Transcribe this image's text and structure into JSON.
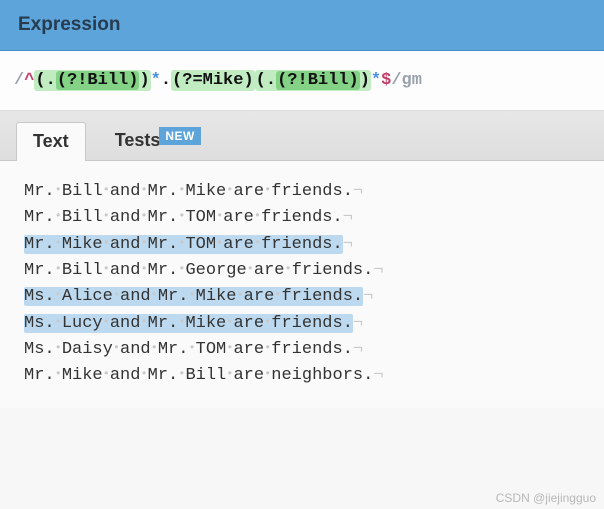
{
  "header": {
    "title": "Expression"
  },
  "regex": {
    "delim_open": "/",
    "anchor_start": "^",
    "group1_open": "(",
    "group1_dot": ".",
    "group1_la_open": "(?!",
    "group1_la_lit": "Bill",
    "group1_la_close": ")",
    "group1_close": ")",
    "star1": "*",
    "mid_dot": ".",
    "mid_la_open": "(?=",
    "mid_la_lit": "Mike",
    "mid_la_close": ")",
    "group2_open": "(",
    "group2_dot": ".",
    "group2_la_open": "(?!",
    "group2_la_lit": "Bill",
    "group2_la_close": ")",
    "group2_close": ")",
    "star2": "*",
    "anchor_end": "$",
    "delim_close": "/",
    "flags": "gm"
  },
  "tabs": {
    "text": "Text",
    "tests": "Tests",
    "badge": "NEW"
  },
  "lines": [
    {
      "text": "Mr. Bill and Mr. Mike are friends.",
      "matched": false
    },
    {
      "text": "Mr. Bill and Mr. TOM are friends.",
      "matched": false
    },
    {
      "text": "Mr. Mike and Mr. TOM are friends.",
      "matched": true
    },
    {
      "text": "Mr. Bill and Mr. George are friends.",
      "matched": false
    },
    {
      "text": "Ms. Alice and Mr. Mike are friends.",
      "matched": true
    },
    {
      "text": "Ms. Lucy and Mr. Mike are friends.",
      "matched": true
    },
    {
      "text": "Ms. Daisy and Mr. TOM are friends.",
      "matched": false
    },
    {
      "text": "Mr. Mike and Mr. Bill are neighbors.",
      "matched": false
    }
  ],
  "watermark": "CSDN @jiejingguo"
}
